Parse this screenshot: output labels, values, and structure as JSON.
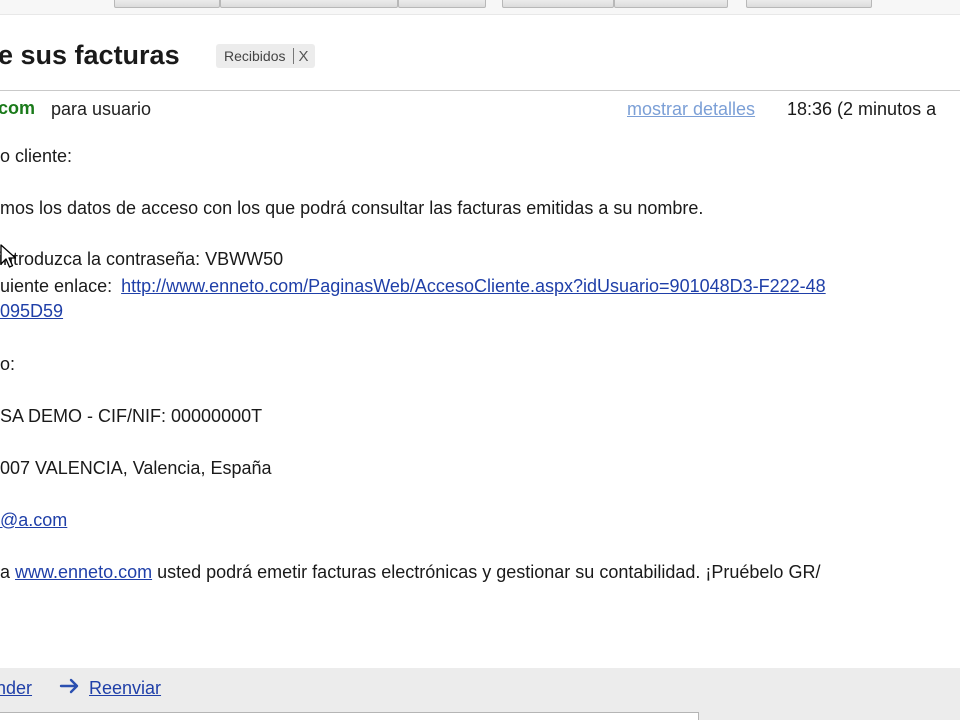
{
  "message": {
    "subject": "e sus facturas",
    "label": "Recibidos",
    "label_remove": "X",
    "sender_domain": "com",
    "recipient": "para usuario",
    "show_details": "mostrar detalles",
    "time": "18:36 (2 minutos a"
  },
  "body": {
    "greeting": "o cliente:",
    "intro": "mos los datos de acceso con los que podrá consultar las facturas emitidas a su nombre.",
    "password_line": "introduzca la contraseña: VBWW50",
    "link_prefix": "uiente enlace: ",
    "access_link": "http://www.enneto.com/PaginasWeb/AccesoCliente.aspx?idUsuario=901048D3-F222-48",
    "access_link_cont": "095D59",
    "signature_intro": "o:",
    "company": "SA DEMO - CIF/NIF: 00000000T",
    "address": "007 VALENCIA, Valencia, España",
    "email": "@a.com",
    "promo_prefix": "a ",
    "promo_link": "www.enneto.com",
    "promo_text": " usted podrá emetir facturas electrónicas y gestionar su contabilidad. ¡Pruébelo GR/"
  },
  "actions": {
    "reply": "nder",
    "forward": "Reenviar"
  },
  "colors": {
    "link": "#1f3fa8",
    "details_link": "#7b9fd6",
    "sender": "#1a7a1a"
  },
  "icons": {
    "forward": "forward-arrow-icon",
    "cursor": "mouse-pointer-icon"
  }
}
